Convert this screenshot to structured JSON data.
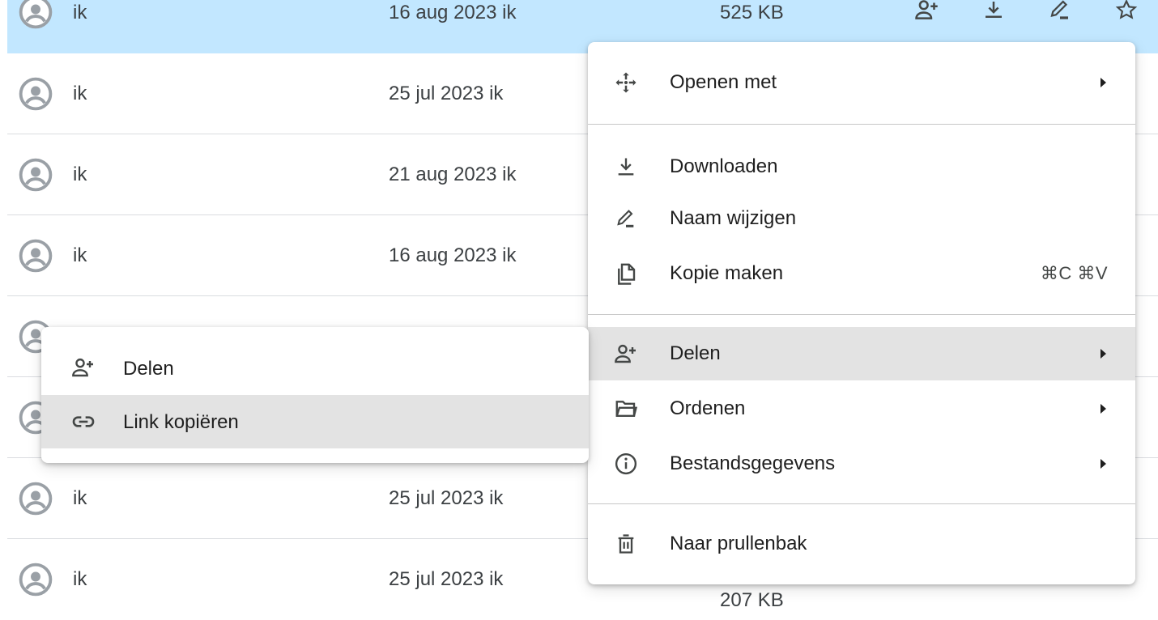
{
  "file_list": {
    "rows": [
      {
        "owner": "ik",
        "modified": "16 aug 2023 ik",
        "size": "525 KB",
        "selected": true
      },
      {
        "owner": "ik",
        "modified": "25 jul 2023 ik",
        "size": ""
      },
      {
        "owner": "ik",
        "modified": "21 aug 2023 ik",
        "size": ""
      },
      {
        "owner": "ik",
        "modified": "16 aug 2023 ik",
        "size": ""
      },
      {
        "owner": "",
        "modified": "",
        "size": ""
      },
      {
        "owner": "",
        "modified": "",
        "size": ""
      },
      {
        "owner": "ik",
        "modified": "25 jul 2023 ik",
        "size": ""
      },
      {
        "owner": "ik",
        "modified": "25 jul 2023 ik",
        "size": "207 KB"
      }
    ],
    "row_action_icons": [
      "share-person-icon",
      "download-icon",
      "rename-pencil-icon",
      "star-icon"
    ]
  },
  "context_menu": {
    "open_with": "Openen met",
    "download": "Downloaden",
    "rename": "Naam wijzigen",
    "make_copy": "Kopie maken",
    "make_copy_shortcut": "⌘C ⌘V",
    "share": "Delen",
    "organize": "Ordenen",
    "file_info": "Bestandsgegevens",
    "trash": "Naar prullenbak"
  },
  "share_submenu": {
    "share": "Delen",
    "copy_link": "Link kopiëren"
  },
  "colors": {
    "selected_row": "#c2e7ff",
    "hover_item": "#e3e3e3",
    "icon": "#444746",
    "avatar": "#9aa0a6"
  }
}
